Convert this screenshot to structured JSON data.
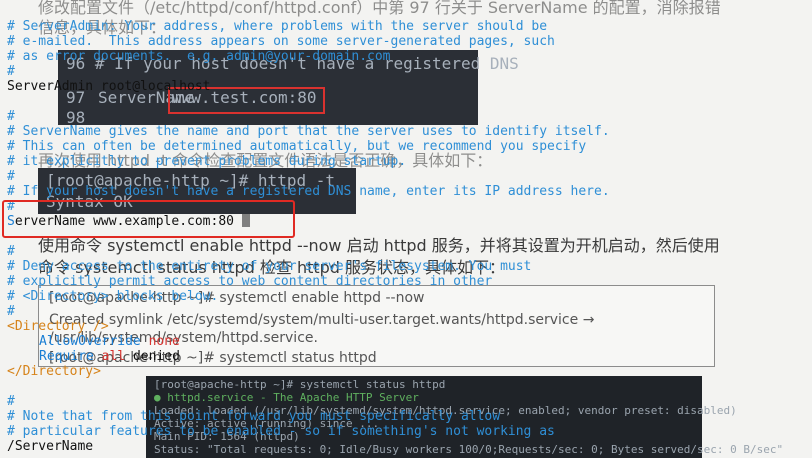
{
  "background": {
    "top_text": "修改配置文件（/etc/httpd/conf/httpd.conf）中第 97 行关于 ServerName 的配置，消除报错",
    "top_text2": "信息，具体如下：",
    "term_top": {
      "line96": "96 # If your host doesn't have a registered DNS",
      "line97_num": "97",
      "line97_key": "ServerName",
      "line97_val": "www.test.com:80",
      "line98": "98"
    },
    "mid_text": "再次使用 httpd -t 命令检查配置文件语法是否正确，具体如下：",
    "term_mid": {
      "prompt": "[root@apache-http ~]# httpd -t",
      "syntax": "Syntax OK"
    },
    "para": "使用命令 systemctl enable httpd --now 启动 httpd 服务，并将其设置为开机启动，然后使用",
    "para2": "命令 systemctl status httpd 检查 httpd 服务状态，具体如下：",
    "codebox": {
      "l1": "[root@apache-http ~]# systemctl enable httpd --now",
      "l2": "Created symlink /etc/systemd/system/multi-user.target.wants/httpd.service →",
      "l3": "/usr/lib/systemd/system/httpd.service.",
      "l4": "[root@apache-http ~]# systemctl status httpd"
    },
    "shell": {
      "l1": "[root@apache-http ~]# systemctl status httpd",
      "l2": "● httpd.service - The Apache HTTP Server",
      "l3": "   Loaded: loaded (/usr/lib/systemd/system/httpd.service; enabled; vendor preset: disabled)",
      "l4": "   Active: active (running) since ...",
      "l5": " Main PID: 1564 (httpd)",
      "l6": "   Status: \"Total requests: 0; Idle/Busy workers 100/0;Requests/sec: 0; Bytes served/sec:   0 B/sec\""
    }
  },
  "editor": {
    "lines": [
      "# ServerAdmin: Your address, where problems with the server should be",
      "# e-mailed.  This address appears on some server-generated pages, such",
      "# as error documents.  e.g. admin@your-domain.com",
      "#",
      "ServerAdmin root@localhost",
      "",
      "#",
      "# ServerName gives the name and port that the server uses to identify itself.",
      "# This can often be determined automatically, but we recommend you specify",
      "# it explicitly to prevent problems during startup.",
      "#",
      "# If your host doesn't have a registered DNS name, enter its IP address here.",
      "#",
      "",
      "",
      "#",
      "# Deny access to the entirety of your server's filesystem. You must",
      "# explicitly permit access to web content directories in other",
      "# <Directory> blocks below.",
      "#"
    ],
    "servername_line": {
      "first_char": "S",
      "rest": "erverName www.example.com:80"
    },
    "dir_open": "<Directory />",
    "allow_key": "AllowOverride",
    "allow_val": "none",
    "require_key": "Require",
    "require_all": "all",
    "require_val": "denied",
    "dir_close": "</Directory>",
    "tail": [
      "#",
      "# Note that from this point forward you must specifically allow",
      "# particular features to be enabled - so if something's not working as"
    ],
    "last_line": "/ServerName"
  }
}
